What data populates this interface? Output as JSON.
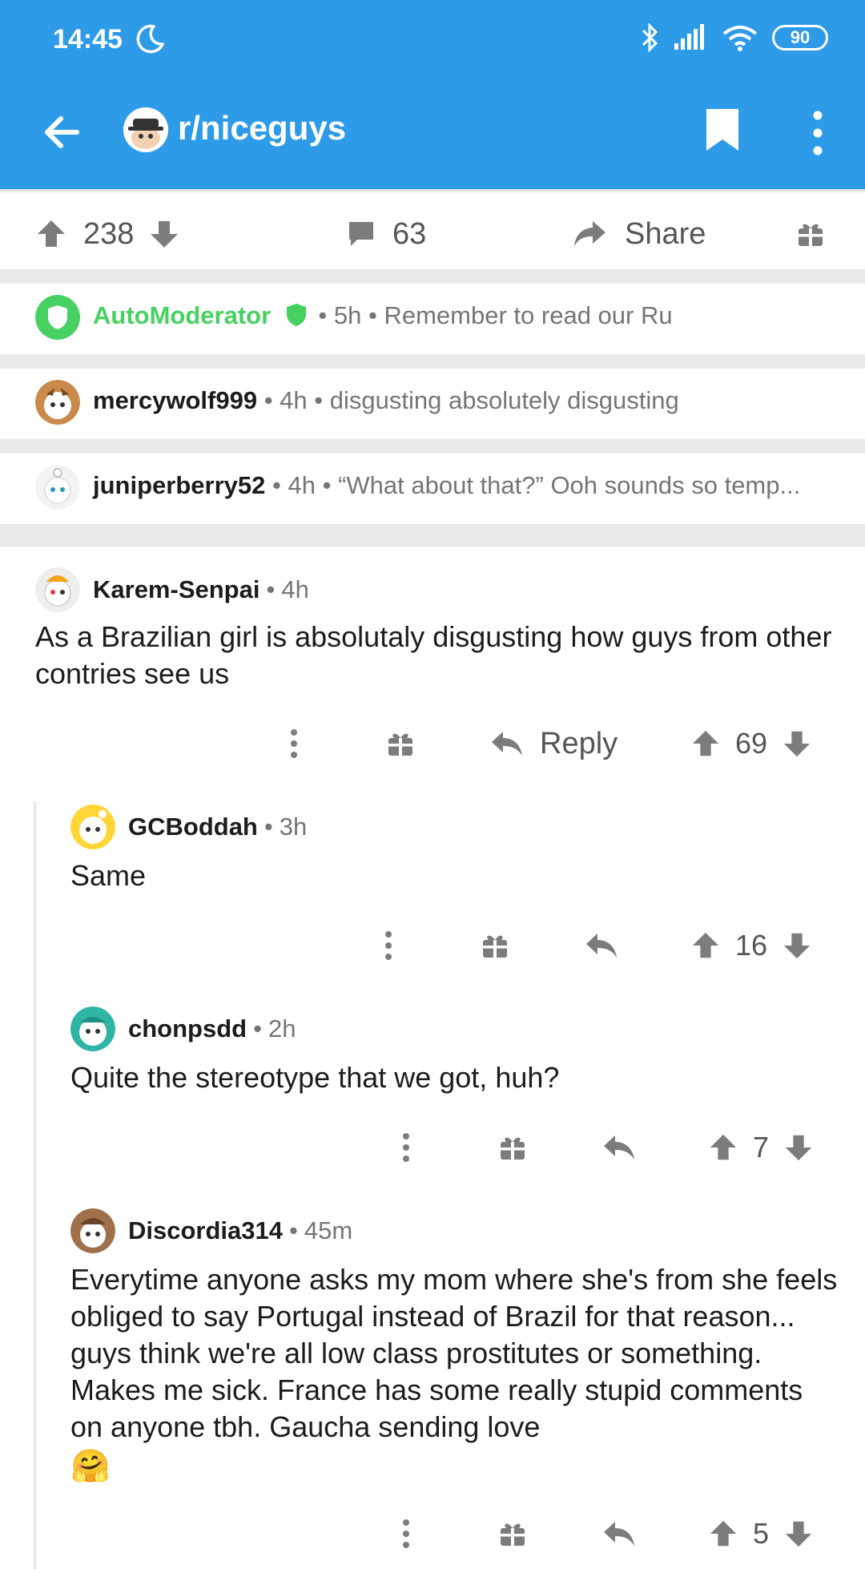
{
  "status_bar": {
    "time": "14:45",
    "battery": "90"
  },
  "app_bar": {
    "subreddit": "r/niceguys"
  },
  "post_actions": {
    "upvotes": "238",
    "comments": "63",
    "share_label": "Share"
  },
  "collapsed_comments": [
    {
      "user": "AutoModerator",
      "time": "5h",
      "preview": "Remember to read our Ru"
    },
    {
      "user": "mercywolf999",
      "time": "4h",
      "preview": "disgusting absolutely disgusting"
    },
    {
      "user": "juniperberry52",
      "time": "4h",
      "preview": "“What about that?” Ooh sounds so temp..."
    }
  ],
  "comments": [
    {
      "user": "Karem-Senpai",
      "time": "4h",
      "body": "As a Brazilian girl is absolutaly disgusting how guys from other contries see us",
      "reply_label": "Reply",
      "score": "69"
    },
    {
      "user": "GCBoddah",
      "time": "3h",
      "body": "Same",
      "score": "16"
    },
    {
      "user": "chonpsdd",
      "time": "2h",
      "body": "Quite the stereotype that we got, huh?",
      "score": "7"
    },
    {
      "user": "Discordia314",
      "time": "45m",
      "body": "Everytime anyone asks my mom where she's from she feels obliged to say Portugal instead of Brazil for that reason... guys think we're all low class prostitutes or something. Makes me sick. France has some really stupid comments on anyone tbh. Gaucha sending love",
      "emoji": "🤗",
      "score": "5"
    }
  ],
  "colors": {
    "header_blue": "#2d9be8",
    "mod_green": "#46d160",
    "icon_gray": "#7c7c7c"
  }
}
